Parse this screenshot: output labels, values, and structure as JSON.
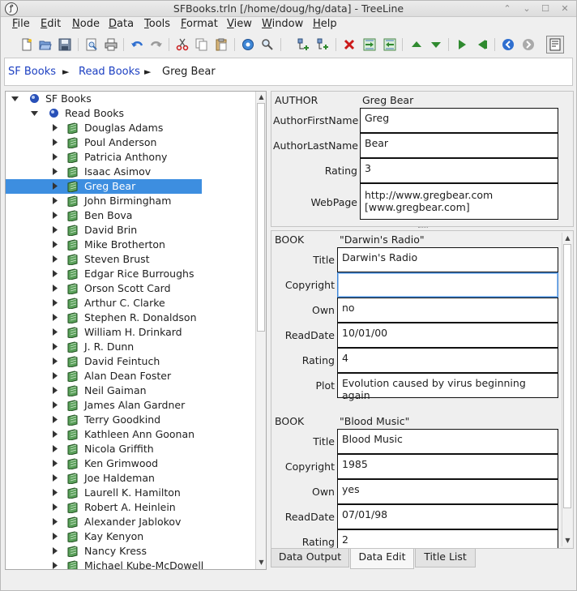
{
  "window": {
    "title": "SFBooks.trln [/home/doug/hg/data] - TreeLine",
    "app_icon": "treeline-app-icon"
  },
  "menu": [
    "File",
    "Edit",
    "Node",
    "Data",
    "Tools",
    "Format",
    "View",
    "Window",
    "Help"
  ],
  "toolbar": {
    "icons": [
      "new-file-icon",
      "open-file-icon",
      "save-icon",
      "print-preview-icon",
      "print-icon",
      "undo-icon",
      "redo-icon",
      "cut-icon",
      "copy-icon",
      "paste-icon",
      "settings-icon",
      "find-icon",
      "add-child-icon",
      "insert-sibling-icon",
      "delete-icon",
      "indent-icon",
      "unindent-icon",
      "move-up-icon",
      "move-down-icon",
      "next-sibling-icon",
      "prev-sibling-icon",
      "forward-icon",
      "back-icon",
      "show-children-icon"
    ],
    "accent_green": "#2f8a2f",
    "accent_red": "#cc1a1a",
    "accent_blue": "#2f6fd0"
  },
  "breadcrumb": {
    "items": [
      "SF Books",
      "Read Books",
      "Greg Bear"
    ],
    "link_color": "#1d40c2"
  },
  "tree": {
    "root": "SF Books",
    "parent": "Read Books",
    "selected": "Greg Bear",
    "selection_color": "#3d8ee0",
    "children": [
      "Douglas Adams",
      "Poul Anderson",
      "Patricia Anthony",
      "Isaac Asimov",
      "Greg Bear",
      "John Birmingham",
      "Ben Bova",
      "David Brin",
      "Mike Brotherton",
      "Steven Brust",
      "Edgar Rice Burroughs",
      "Orson Scott Card",
      "Arthur C. Clarke",
      "Stephen R. Donaldson",
      "William H. Drinkard",
      "J. R. Dunn",
      "David Feintuch",
      "Alan Dean Foster",
      "Neil Gaiman",
      "James Alan Gardner",
      "Terry Goodkind",
      "Kathleen Ann Goonan",
      "Nicola Griffith",
      "Ken Grimwood",
      "Joe Haldeman",
      "Laurell K. Hamilton",
      "Robert A. Heinlein",
      "Alexander Jablokov",
      "Kay Kenyon",
      "Nancy Kress",
      "Michael Kube-McDowell"
    ]
  },
  "author": {
    "type": "AUTHOR",
    "title": "Greg Bear",
    "fields": [
      {
        "label": "AuthorFirstName",
        "value": "Greg"
      },
      {
        "label": "AuthorLastName",
        "value": "Bear"
      },
      {
        "label": "Rating",
        "value": "3"
      },
      {
        "label": "WebPage",
        "value": "http://www.gregbear.com\n[www.gregbear.com]"
      }
    ]
  },
  "books": [
    {
      "type": "BOOK",
      "title": "\"Darwin's Radio\"",
      "fields": [
        {
          "label": "Title",
          "value": "Darwin's Radio"
        },
        {
          "label": "Copyright",
          "value": ""
        },
        {
          "label": "Own",
          "value": "no"
        },
        {
          "label": "ReadDate",
          "value": "10/01/00"
        },
        {
          "label": "Rating",
          "value": "4"
        },
        {
          "label": "Plot",
          "value": "Evolution caused by virus beginning again"
        }
      ]
    },
    {
      "type": "BOOK",
      "title": "\"Blood Music\"",
      "fields": [
        {
          "label": "Title",
          "value": "Blood Music"
        },
        {
          "label": "Copyright",
          "value": "1985"
        },
        {
          "label": "Own",
          "value": "yes"
        },
        {
          "label": "ReadDate",
          "value": "07/01/98"
        },
        {
          "label": "Rating",
          "value": "2"
        }
      ]
    }
  ],
  "tabs": [
    {
      "label": "Data Output",
      "active": false
    },
    {
      "label": "Data Edit",
      "active": true
    },
    {
      "label": "Title List",
      "active": false
    }
  ]
}
